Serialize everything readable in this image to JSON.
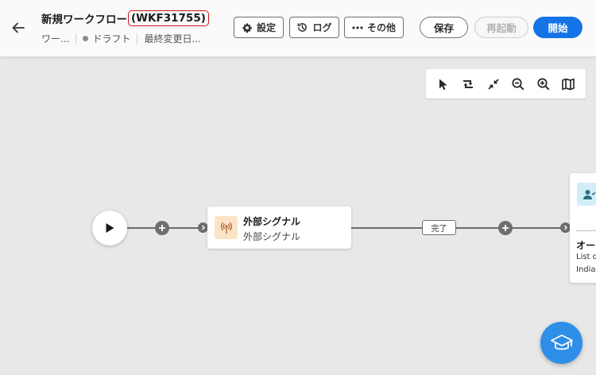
{
  "header": {
    "title": "新規ワークフロー",
    "workflow_id": "(WKF31755)",
    "meta": {
      "type": "ワー...",
      "status": "ドラフト",
      "last_modified": "最終変更日..."
    },
    "buttons": {
      "settings": "設定",
      "log": "ログ",
      "more": "その他",
      "save": "保存",
      "restart": "再起動",
      "start": "開始"
    }
  },
  "toolbar": {
    "tools": [
      "select-icon",
      "rearrange-icon",
      "collapse-icon",
      "zoom-out-icon",
      "zoom-in-icon",
      "map-icon"
    ]
  },
  "canvas": {
    "activity": {
      "title": "外部シグナル",
      "subtitle": "外部シグナル"
    },
    "transition_label": "完了",
    "next_activity": {
      "title": "オーデ",
      "line1": "List of",
      "line2": "India ("
    }
  },
  "colors": {
    "primary": "#1473e6",
    "highlight_border": "#d0191e",
    "signal_icon_bg": "#fbe4c6",
    "signal_icon_fg": "#b8693c",
    "audience_icon_bg": "#d1eef6",
    "help_button": "#2e8ee8"
  }
}
